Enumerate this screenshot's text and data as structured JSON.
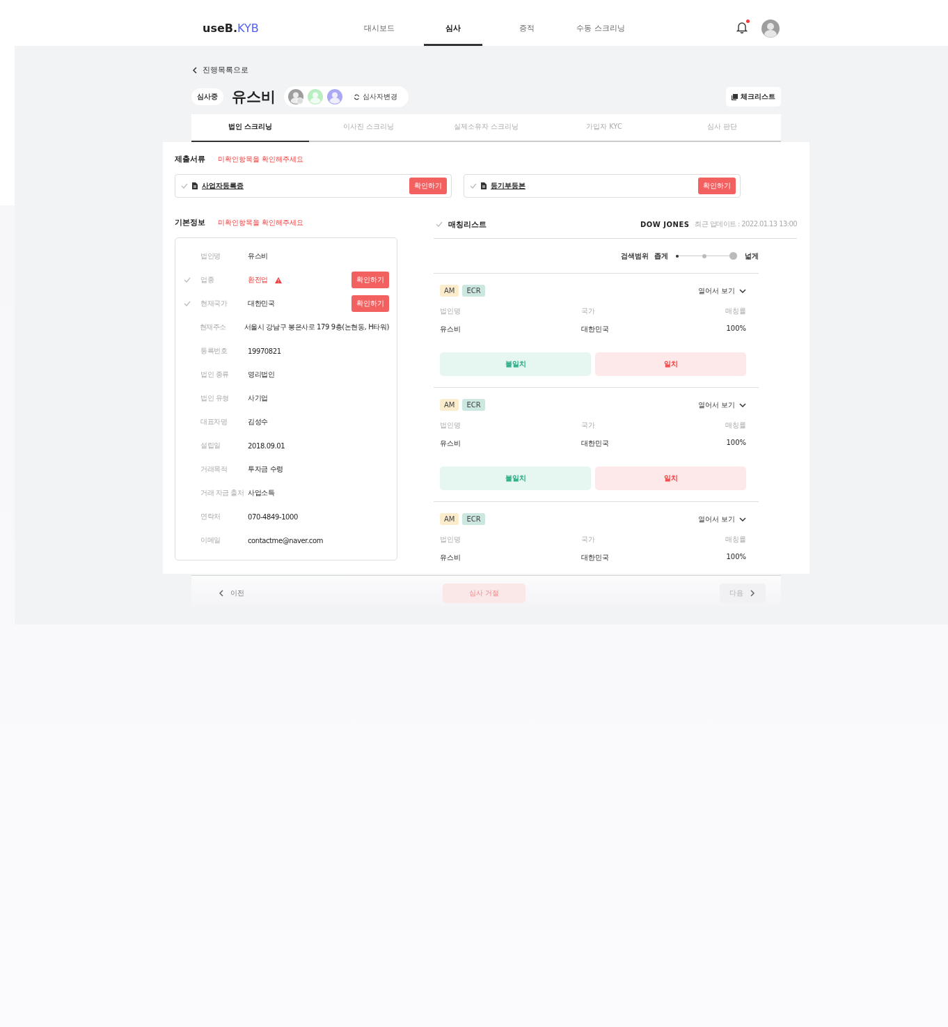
{
  "header": {
    "logo_prefix": "useB.",
    "logo_suffix": "KYB",
    "nav": [
      {
        "label": "대시보드",
        "selected": false
      },
      {
        "label": "심사",
        "selected": true
      },
      {
        "label": "증적",
        "selected": false
      },
      {
        "label": "수동 스크리닝",
        "selected": false
      }
    ],
    "notification": {
      "unread": true
    }
  },
  "back_link": "진행목록으로",
  "case": {
    "status": "심사중",
    "name": "유스비",
    "reviewers": [
      {
        "color": "#9e9e9e",
        "badge": true
      },
      {
        "color": "#b9eec0",
        "badge": false
      },
      {
        "color": "#aaa8f5",
        "badge": false
      }
    ],
    "change_reviewer": "심사자변경",
    "checklist": "체크리스트"
  },
  "tabs": [
    {
      "label": "법인 스크리닝",
      "selected": true
    },
    {
      "label": "이사진 스크리닝",
      "selected": false
    },
    {
      "label": "실제소유자 스크리닝",
      "selected": false
    },
    {
      "label": "가입자 KYC",
      "selected": false
    },
    {
      "label": "심사 판단",
      "selected": false
    }
  ],
  "documents": {
    "title": "제출서류",
    "warning": "미확인항목을 확인해주세요",
    "items": [
      {
        "name": "사업자등록증",
        "checked": false,
        "button": "확인하기"
      },
      {
        "name": "등기부등본",
        "checked": false,
        "button": "확인하기"
      }
    ]
  },
  "basic_info": {
    "title": "기본정보",
    "warning": "미확인항목을 확인해주세요",
    "rows": [
      {
        "kind": "plain",
        "label": "법인명",
        "value": "유스비"
      },
      {
        "kind": "verify",
        "label": "업종",
        "value": "환전업",
        "checked": false,
        "alert": true,
        "button": "확인하기"
      },
      {
        "kind": "verify",
        "label": "현재국가",
        "value": "대한민국",
        "checked": false,
        "alert": false,
        "button": "확인하기"
      },
      {
        "kind": "plain",
        "label": "현재주소",
        "value": "서울시 강남구 봉은사로 179 9층(논현동, H타워)"
      },
      {
        "kind": "plain",
        "label": "등록번호",
        "value": "19970821"
      },
      {
        "kind": "plain",
        "label": "법인 종류",
        "value": "영리법인"
      },
      {
        "kind": "plain",
        "label": "법인 유형",
        "value": "사기업"
      },
      {
        "kind": "plain",
        "label": "대표자명",
        "value": "김성수"
      },
      {
        "kind": "plain",
        "label": "설립일",
        "value": "2018.09.01"
      },
      {
        "kind": "plain",
        "label": "거래목적",
        "value": "투자금 수령"
      },
      {
        "kind": "plain",
        "label": "거래 자금 출처",
        "value": "사업소득"
      },
      {
        "kind": "plain",
        "label": "연락처",
        "value": "070-4849-1000"
      },
      {
        "kind": "plain",
        "label": "이메일",
        "value": "contactme@naver.com"
      }
    ]
  },
  "matching": {
    "title": "매칭리스트",
    "checked": false,
    "source": "DOW JONES",
    "updated": "최근 업데이트 : 2022.01.13 13:00",
    "range": {
      "label": "검색범위",
      "min_label": "좁게",
      "max_label": "넓게",
      "level": 1
    },
    "results": [
      {
        "tags": [
          {
            "label": "AM",
            "color": "#fbeccb"
          },
          {
            "label": "ECR",
            "color": "#cce6e0"
          }
        ],
        "expand": "열어서 보기",
        "columns": [
          "법인명",
          "국가",
          "매칭률"
        ],
        "values": [
          "유스비",
          "대한민국",
          "100%"
        ],
        "mismatch": "불일치",
        "match": "일치"
      },
      {
        "tags": [
          {
            "label": "AM",
            "color": "#fbeccb"
          },
          {
            "label": "ECR",
            "color": "#cce6e0"
          }
        ],
        "expand": "열어서 보기",
        "columns": [
          "법인명",
          "국가",
          "매칭률"
        ],
        "values": [
          "유스비",
          "대한민국",
          "100%"
        ],
        "mismatch": "불일치",
        "match": "일치"
      },
      {
        "tags": [
          {
            "label": "AM",
            "color": "#fbeccb"
          },
          {
            "label": "ECR",
            "color": "#cce6e0"
          }
        ],
        "expand": "열어서 보기",
        "columns": [
          "법인명",
          "국가",
          "매칭률"
        ],
        "values": [
          "유스비",
          "대한민국",
          "100%"
        ]
      }
    ]
  },
  "footer": {
    "prev": "이전",
    "reject": "심사 거절",
    "next": "다음"
  }
}
